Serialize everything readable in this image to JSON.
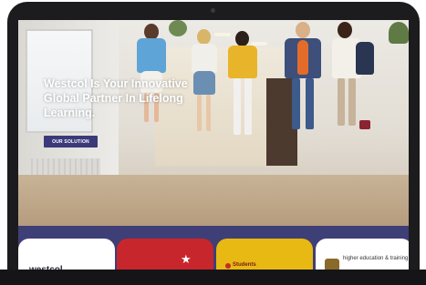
{
  "hero": {
    "headline": "Westcol Is Your Innovative Global Partner In Lifelong Learning.",
    "cta_label": "OUR SOLUTION"
  },
  "partners": [
    {
      "label": "westcol",
      "color": "#ffffff"
    },
    {
      "label": "",
      "color": "#c8262d"
    },
    {
      "label": "Students",
      "color": "#e8b913"
    },
    {
      "label": "higher education & training",
      "color": "#ffffff"
    }
  ],
  "colors": {
    "accent": "#3e3f76",
    "cta": "#3a3a7a",
    "device": "#1c1c1e"
  }
}
